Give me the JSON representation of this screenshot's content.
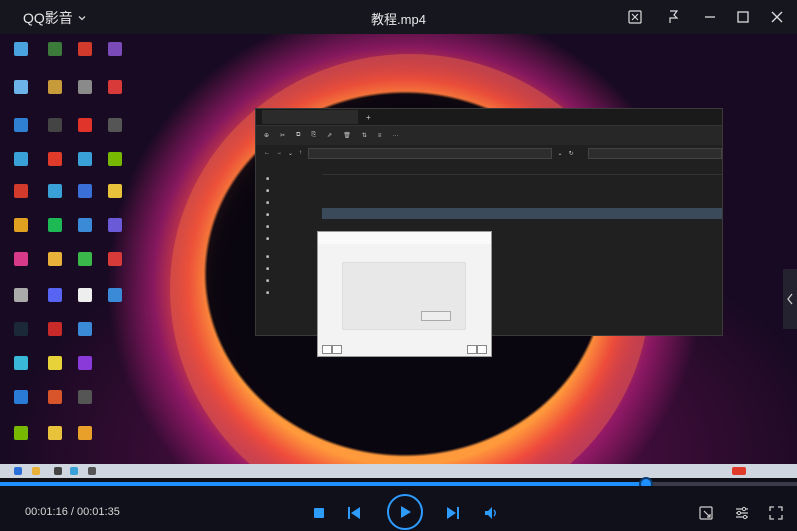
{
  "app": {
    "name": "QQ影音",
    "video_title": "教程.mp4"
  },
  "playback": {
    "current_time": "00:01:16",
    "total_time": "00:01:35",
    "progress": 0.81
  },
  "colors": {
    "accent": "#1e8fff",
    "titlebar_bg": "#16161f",
    "controls_bg": "#10101a"
  },
  "icons": {
    "app_menu": "chevron-down-icon",
    "window": [
      "screenshot-icon",
      "pin-icon",
      "minimize-icon",
      "maximize-icon",
      "close-icon"
    ],
    "controls": [
      "stop-icon",
      "previous-icon",
      "play-icon",
      "next-icon",
      "volume-icon"
    ],
    "right": [
      "screenshot-tool-icon",
      "settings-sliders-icon",
      "fullscreen-icon"
    ]
  }
}
